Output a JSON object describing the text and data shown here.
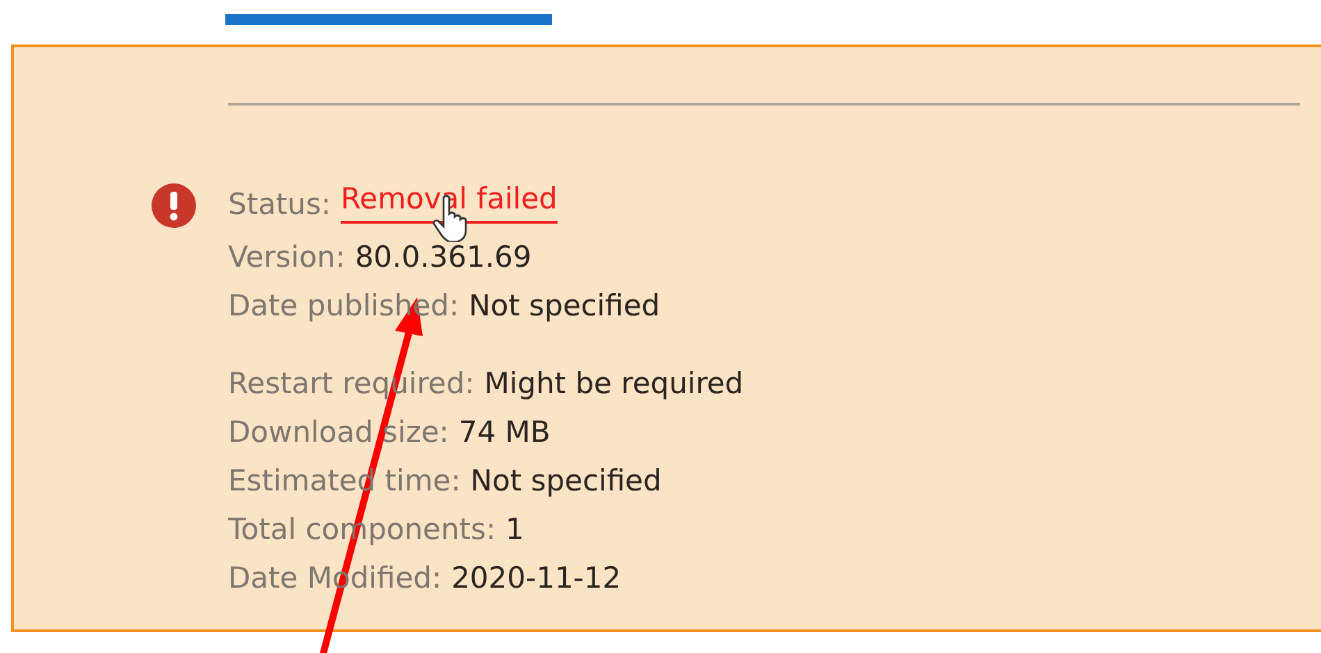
{
  "status": {
    "label": "Status:",
    "value": "Removal failed"
  },
  "groups": [
    [
      {
        "label": "Version:",
        "value": "80.0.361.69"
      },
      {
        "label": "Date published:",
        "value": "Not specified"
      }
    ],
    [
      {
        "label": "Restart required:",
        "value": "Might be required"
      },
      {
        "label": "Download size:",
        "value": "74 MB"
      },
      {
        "label": "Estimated time:",
        "value": "Not specified"
      },
      {
        "label": "Total components:",
        "value": "1"
      },
      {
        "label": "Date Modified:",
        "value": "2020-11-12"
      }
    ]
  ]
}
